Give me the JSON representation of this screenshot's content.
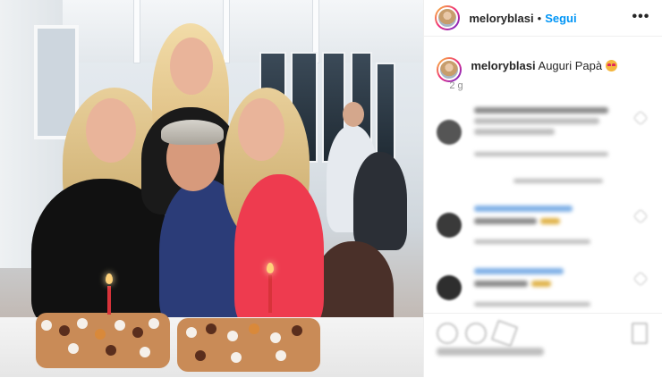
{
  "post": {
    "author": "meloryblasi",
    "follow_label": "Segui",
    "separator": "•",
    "more_label": "•••",
    "caption": "Auguri Papà",
    "caption_emoji": "heart-eyes-emoji",
    "timestamp": "2 g"
  },
  "colors": {
    "accent": "#0095f6",
    "text": "#262626",
    "muted": "#8e8e8e",
    "border": "#efefef"
  },
  "icons": {
    "more": "more-options-icon",
    "like": "heart-icon",
    "comment": "comment-icon",
    "share": "share-icon",
    "save": "bookmark-icon"
  }
}
